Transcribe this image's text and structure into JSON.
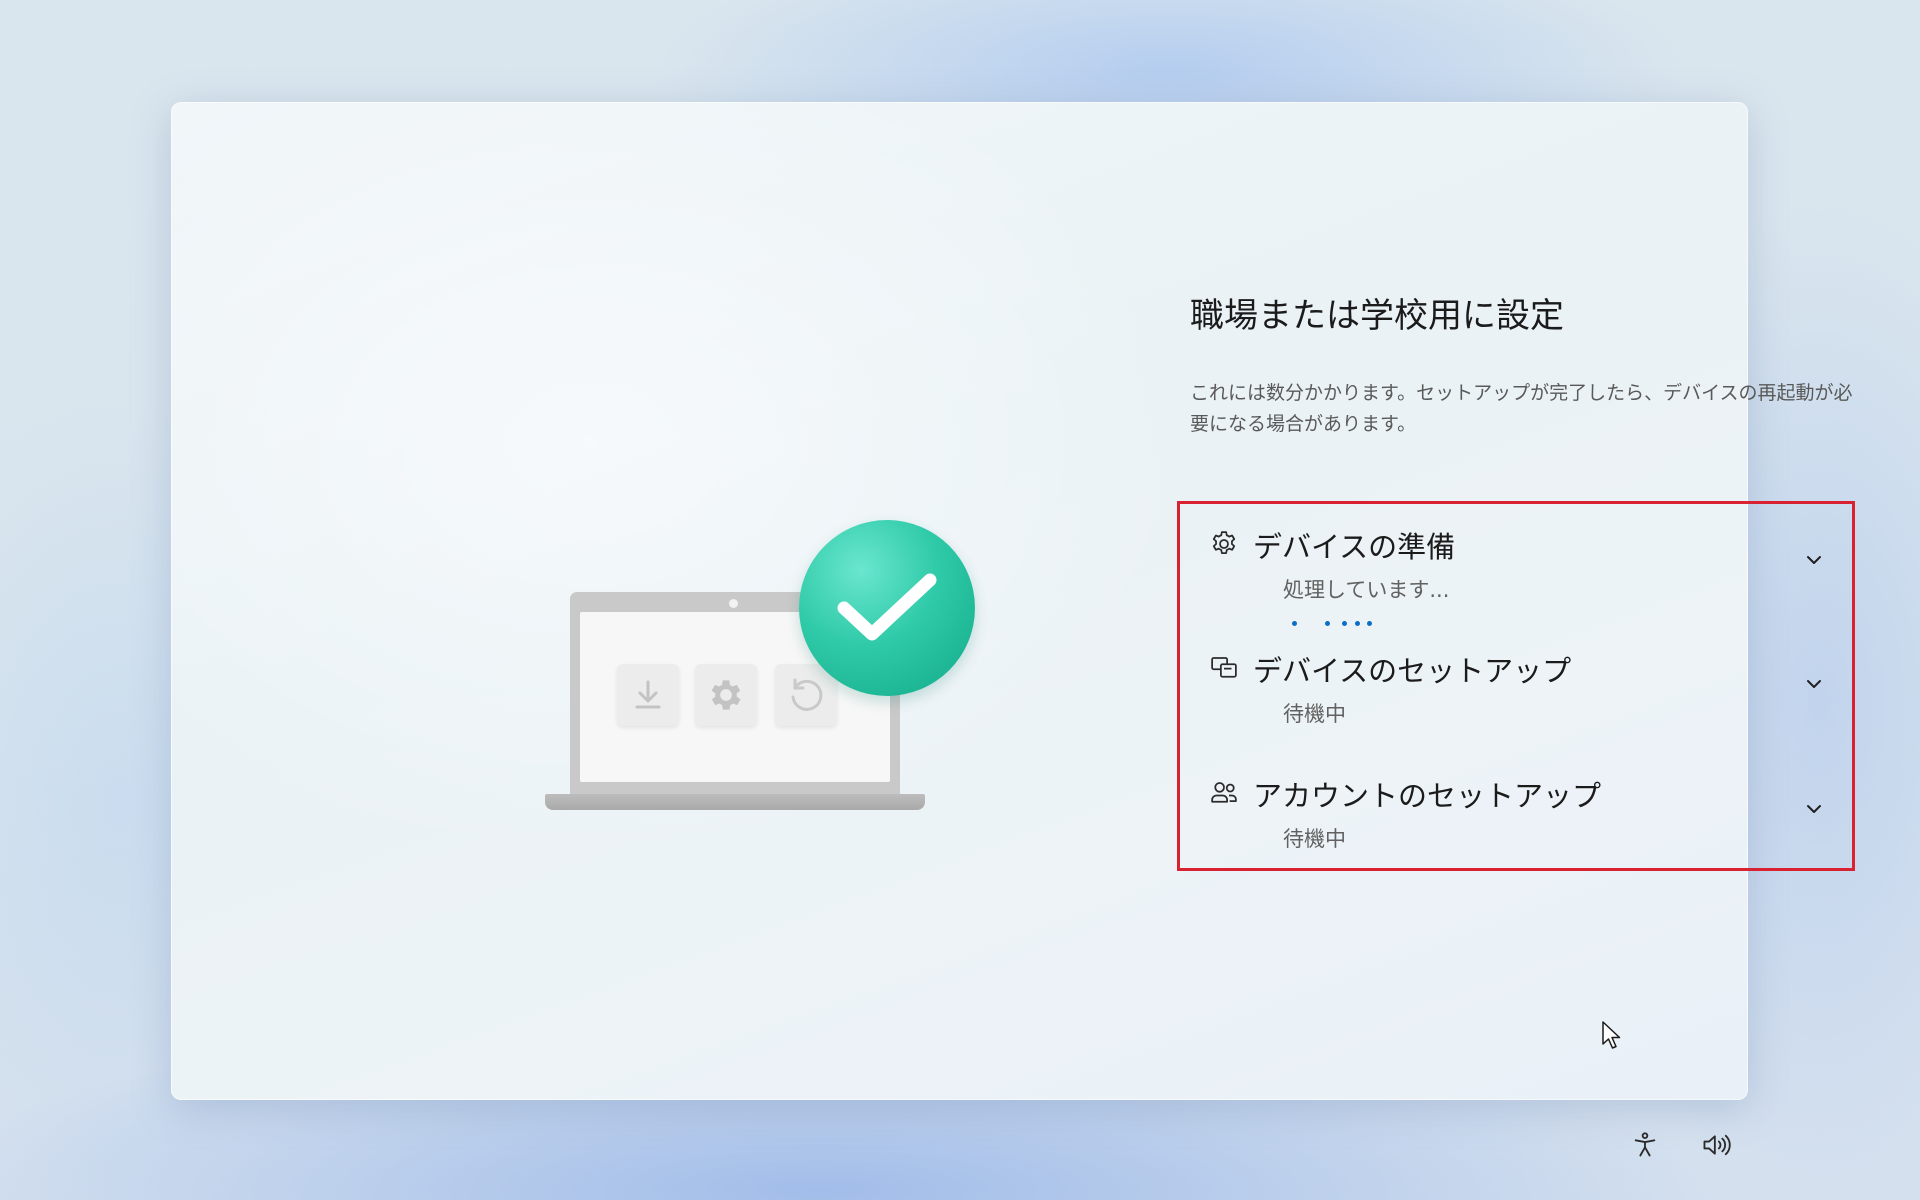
{
  "setup": {
    "title": "職場または学校用に設定",
    "description": "これには数分かかります。セットアップが完了したら、デバイスの再起動が必要になる場合があります。",
    "steps": [
      {
        "title": "デバイスの準備",
        "status": "処理しています...",
        "icon": "gear-icon",
        "state": "in-progress"
      },
      {
        "title": "デバイスのセットアップ",
        "status": "待機中",
        "icon": "device-setup-icon",
        "state": "waiting"
      },
      {
        "title": "アカウントのセットアップ",
        "status": "待機中",
        "icon": "people-icon",
        "state": "waiting"
      }
    ]
  },
  "illustration": {
    "icons": [
      "download-icon",
      "gear-icon",
      "refresh-icon",
      "checkmark-icon"
    ]
  },
  "system_tray": {
    "icons": [
      "accessibility-icon",
      "volume-icon"
    ]
  },
  "colors": {
    "highlight_border": "#d92231",
    "progress_accent": "#0b6fc4",
    "check_badge": "#2fcaa8"
  }
}
